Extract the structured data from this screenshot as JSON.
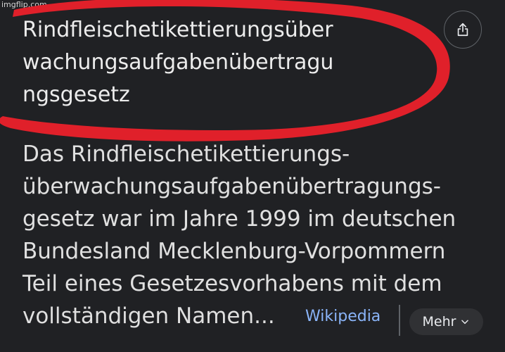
{
  "watermark": "imgflip.com",
  "result": {
    "title_lines": [
      "Rindfleischetikettierungsüber",
      "wachungsaufgabenübertragu",
      "ngsgesetz"
    ],
    "snippet_lines": [
      "Das Rindfleischetikettierungs-",
      "überwachungsaufgabenübertragungs-",
      "gesetz war im Jahre 1999 im deutschen",
      "Bundesland Mecklenburg-Vorpommern",
      "Teil eines Gesetzesvorhabens mit dem",
      "vollständigen Namen..."
    ],
    "source": "Wikipedia",
    "more_label": "Mehr"
  },
  "icons": {
    "share": "share-icon",
    "chevron": "chevron-down-icon"
  },
  "colors": {
    "background": "#202124",
    "text": "#e8eaed",
    "link": "#8ab4f8",
    "annotation": "#e0202a"
  }
}
